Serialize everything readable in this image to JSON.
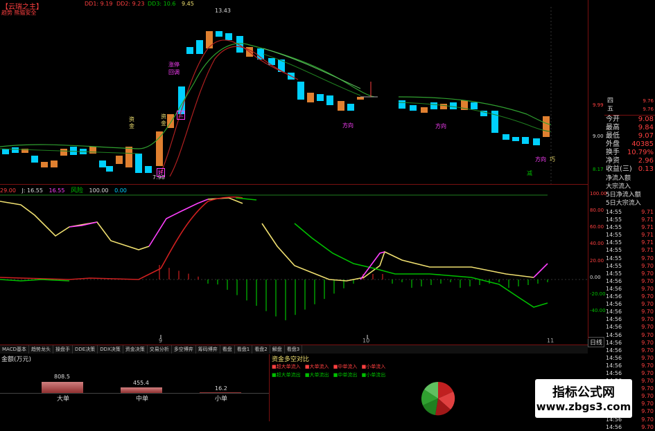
{
  "header": {
    "title": "【云瑞之主】",
    "subtitle": "趋势 熊猫安全",
    "top_indicators": [
      "DD1: 9.19",
      "DD2: 9.23",
      "DD3: 10.6",
      "9.45"
    ],
    "peak_price": "13.43",
    "low_price": "7.98"
  },
  "chart_labels": {
    "zijin_left": "资金",
    "zijin_mid": "资金",
    "signal_1": "涨停",
    "signal_2": "回调",
    "marker_san": "三",
    "marker_hao": "好",
    "pink_1": "方向",
    "pink_2": "方向",
    "pink_3": "方向",
    "green_note": "减",
    "pink_right": "巧"
  },
  "axis": {
    "top_ticks": [
      "9.99",
      "9.00",
      "8.17"
    ],
    "ind_ticks": [
      "100.00",
      "80.00",
      "60.00",
      "40.00",
      "20.00",
      "0.00",
      "-20.00",
      "-40.00"
    ],
    "date_ticks": [
      "9",
      "10",
      "11"
    ],
    "date_btn": "日线"
  },
  "indicator_header": {
    "label1": "29.00",
    "j_label": "J: 16.55",
    "value2": "16.55",
    "name": "风险",
    "value3": "100.00",
    "value4": "0.00"
  },
  "quote_panel": {
    "weekday": [
      "四",
      "五"
    ],
    "right_vals": [
      "9.76",
      "9.76"
    ],
    "rows": [
      {
        "label": "今开",
        "value": "9.08"
      },
      {
        "label": "最高",
        "value": "9.84"
      },
      {
        "label": "最低",
        "value": "9.07"
      },
      {
        "label": "外盘",
        "value": "40385"
      },
      {
        "label": "换手",
        "value": "10.79%"
      },
      {
        "label": "净资",
        "value": "2.96"
      },
      {
        "label": "收益(三)",
        "value": "0.13"
      }
    ],
    "flow_rows": [
      "净流入额",
      "大宗流入",
      "5日净流入额",
      "5日大宗流入"
    ]
  },
  "ticks": [
    {
      "t": "14:55",
      "p": "9.71"
    },
    {
      "t": "14:55",
      "p": "9.71"
    },
    {
      "t": "14:55",
      "p": "9.71"
    },
    {
      "t": "14:55",
      "p": "9.71"
    },
    {
      "t": "14:55",
      "p": "9.71"
    },
    {
      "t": "14:55",
      "p": "9.71"
    },
    {
      "t": "14:55",
      "p": "9.70"
    },
    {
      "t": "14:55",
      "p": "9.70"
    },
    {
      "t": "14:55",
      "p": "9.70"
    },
    {
      "t": "14:56",
      "p": "9.70"
    },
    {
      "t": "14:56",
      "p": "9.70"
    },
    {
      "t": "14:56",
      "p": "9.70"
    },
    {
      "t": "14:56",
      "p": "9.70"
    },
    {
      "t": "14:56",
      "p": "9.70"
    },
    {
      "t": "14:56",
      "p": "9.70"
    },
    {
      "t": "14:56",
      "p": "9.70"
    },
    {
      "t": "14:56",
      "p": "9.70"
    },
    {
      "t": "14:56",
      "p": "9.70"
    },
    {
      "t": "14:56",
      "p": "9.70"
    },
    {
      "t": "14:56",
      "p": "9.70"
    },
    {
      "t": "14:56",
      "p": "9.70"
    },
    {
      "t": "14:56",
      "p": "9.70"
    },
    {
      "t": "14:56",
      "p": "9.70"
    },
    {
      "t": "14:56",
      "p": "9.70"
    },
    {
      "t": "14:56",
      "p": "9.70"
    },
    {
      "t": "14:56",
      "p": "9.70"
    },
    {
      "t": "14:56",
      "p": "9.70"
    },
    {
      "t": "14:56",
      "p": "9.70"
    },
    {
      "t": "14:56",
      "p": "9.70"
    }
  ],
  "tabs": [
    "MACD基本",
    "趋势龙头",
    "操盘手",
    "DDE决策",
    "DDX决策",
    "资金决策",
    "交易分析",
    "多空博弈",
    "筹码博弈",
    "看盘",
    "看盘1",
    "看盘2",
    "解盘",
    "看盘3"
  ],
  "bottom_left": {
    "title": "金额(万元)",
    "bars": [
      {
        "label": "大单",
        "value": "808.5"
      },
      {
        "label": "中单",
        "value": "455.4"
      },
      {
        "label": "小单",
        "value": "16.2"
      }
    ]
  },
  "bottom_mid": {
    "title": "资金多空对比",
    "row1": [
      "超大单流入",
      "大单流入",
      "中单流入",
      "小单流入"
    ],
    "row2": [
      "超大单流出",
      "大单流出",
      "中单流出",
      "小单流出"
    ]
  },
  "watermark": {
    "line1": "指标公式网",
    "line2": "www.zbgs3.com"
  },
  "colors": {
    "up": "#ff4040",
    "down": "#00c000",
    "cyan": "#00d0ff",
    "orange": "#e08030",
    "yellow": "#f0e070",
    "magenta": "#ff40ff",
    "panel_border": "#7a1010"
  }
}
